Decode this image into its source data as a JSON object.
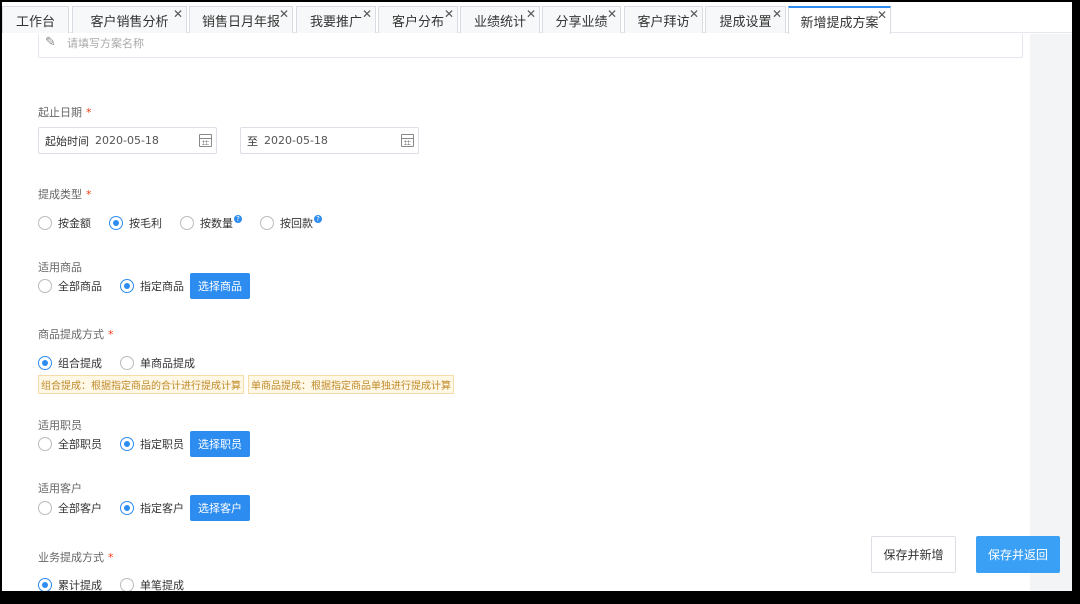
{
  "tabs": [
    {
      "label": "工作台",
      "closable": false,
      "active": false
    },
    {
      "label": "客户销售分析",
      "closable": true,
      "active": false
    },
    {
      "label": "销售日月年报",
      "closable": true,
      "active": false
    },
    {
      "label": "我要推广",
      "closable": true,
      "active": false
    },
    {
      "label": "客户分布",
      "closable": true,
      "active": false
    },
    {
      "label": "业绩统计",
      "closable": true,
      "active": false
    },
    {
      "label": "分享业绩",
      "closable": true,
      "active": false
    },
    {
      "label": "客户拜访",
      "closable": true,
      "active": false
    },
    {
      "label": "提成设置",
      "closable": true,
      "active": false
    },
    {
      "label": "新增提成方案",
      "closable": true,
      "active": true
    }
  ],
  "close_glyph": "✕",
  "scheme_name": {
    "placeholder": "请填写方案名称",
    "value": "",
    "icon": "pencil-icon"
  },
  "required_mark": "*",
  "date_range": {
    "label": "起止日期",
    "start_prefix": "起始时间",
    "start_value": "2020-05-18",
    "end_prefix": "至",
    "end_value": "2020-05-18",
    "icon": "calendar-icon"
  },
  "commission_type": {
    "label": "提成类型",
    "options": [
      "按金额",
      "按毛利",
      "按数量",
      "按回款"
    ],
    "selected": "按毛利",
    "help_glyph": "?"
  },
  "goods": {
    "label": "适用商品",
    "options": [
      "全部商品",
      "指定商品"
    ],
    "selected": "指定商品",
    "button": "选择商品"
  },
  "goods_method": {
    "label": "商品提成方式",
    "options": [
      "组合提成",
      "单商品提成"
    ],
    "selected": "组合提成",
    "tips": [
      "组合提成：根据指定商品的合计进行提成计算",
      "单商品提成：根据指定商品单独进行提成计算"
    ]
  },
  "staff": {
    "label": "适用职员",
    "options": [
      "全部职员",
      "指定职员"
    ],
    "selected": "指定职员",
    "button": "选择职员"
  },
  "customer": {
    "label": "适用客户",
    "options": [
      "全部客户",
      "指定客户"
    ],
    "selected": "指定客户",
    "button": "选择客户"
  },
  "business_method": {
    "label": "业务提成方式",
    "options": [
      "累计提成",
      "单笔提成"
    ],
    "selected": "累计提成"
  },
  "actions": {
    "save_new": "保存并新增",
    "save_return": "保存并返回"
  },
  "colors": {
    "primary": "#2d8cf0",
    "required": "#ed4014",
    "tip_bg": "#fff8e6",
    "tip_text": "#c08a2a"
  }
}
